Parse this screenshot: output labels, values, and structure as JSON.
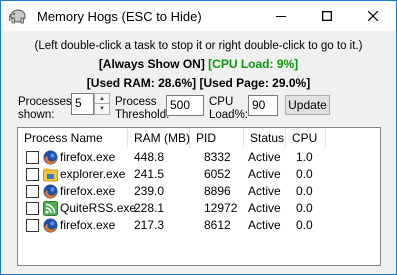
{
  "window": {
    "title": "Memory Hogs (ESC to Hide)",
    "accent": "#1979ca"
  },
  "info": {
    "instructions": "(Left double-click a task to stop it or right double-click to go to it.)",
    "always_show": "[Always Show ON]",
    "cpu_load": "[CPU Load: 9%]",
    "used_ram": "[Used RAM: 28.6%]",
    "used_page": "[Used Page: 29.0%]"
  },
  "controls": {
    "processes_label_1": "Processes",
    "processes_label_2": "shown:",
    "processes_value": "5",
    "threshold_label_1": "Process",
    "threshold_label_2": "Threshold:",
    "threshold_value": "500",
    "cpu_label_1": "CPU",
    "cpu_label_2": "Load%:",
    "cpu_value": "90",
    "update_label": "Update"
  },
  "table": {
    "headers": [
      "Process Name",
      "RAM (MB)",
      "PID",
      "Status",
      "CPU"
    ],
    "rows": [
      {
        "name": "firefox.exe",
        "ram": "448.8",
        "pid": "8332",
        "status": "Active",
        "cpu": "1.0",
        "icon": "firefox-icon"
      },
      {
        "name": "explorer.exe",
        "ram": "241.5",
        "pid": "6052",
        "status": "Active",
        "cpu": "0.0",
        "icon": "explorer-folder-icon"
      },
      {
        "name": "firefox.exe",
        "ram": "239.0",
        "pid": "8896",
        "status": "Active",
        "cpu": "0.0",
        "icon": "firefox-icon"
      },
      {
        "name": "QuiteRSS.exe",
        "ram": "228.1",
        "pid": "12972",
        "status": "Active",
        "cpu": "0.0",
        "icon": "rss-icon"
      },
      {
        "name": "firefox.exe",
        "ram": "217.3",
        "pid": "8612",
        "status": "Active",
        "cpu": "0.0",
        "icon": "firefox-icon"
      }
    ]
  }
}
